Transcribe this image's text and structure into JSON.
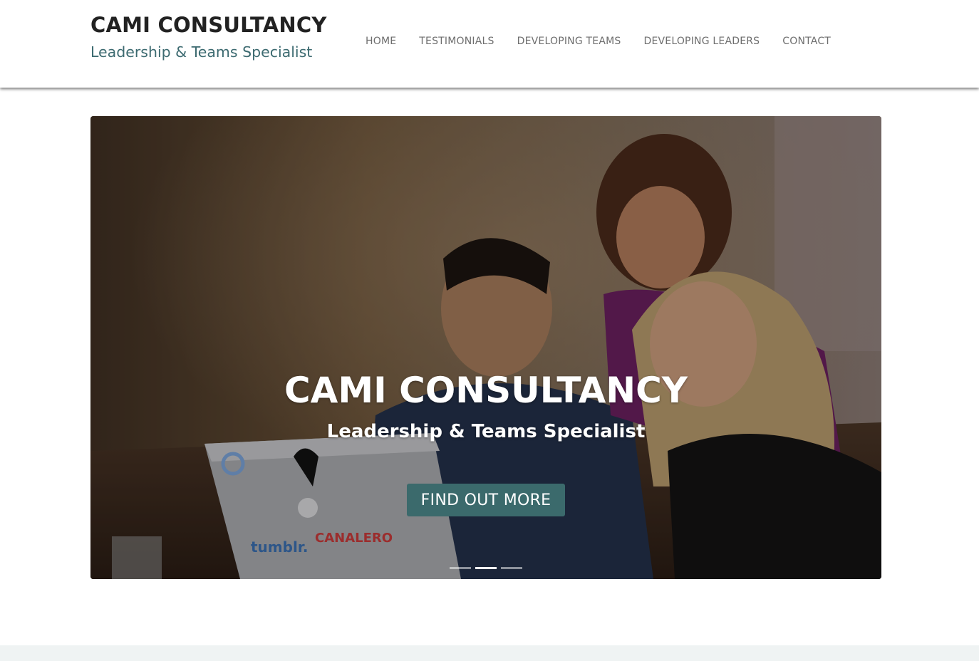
{
  "header": {
    "brand_title": "CAMI CONSULTANCY",
    "brand_tagline": "Leadership & Teams Specialist",
    "nav_items": [
      "HOME",
      "TESTIMONIALS",
      "DEVELOPING TEAMS",
      "DEVELOPING LEADERS",
      "CONTACT"
    ]
  },
  "hero": {
    "title": "CAMI CONSULTANCY",
    "subtitle": "Leadership & Teams Specialist",
    "cta_label": "FIND OUT MORE",
    "photo_laptop_stickers": [
      "tumblr.",
      "CANALERO"
    ],
    "slide_count": 3,
    "active_slide": 2
  },
  "colors": {
    "accent": "#3b6a6c",
    "tagline": "#3c6a70",
    "nav_text": "#6e6e6e",
    "brand_text": "#222222",
    "footer_band": "#eff3f3"
  }
}
